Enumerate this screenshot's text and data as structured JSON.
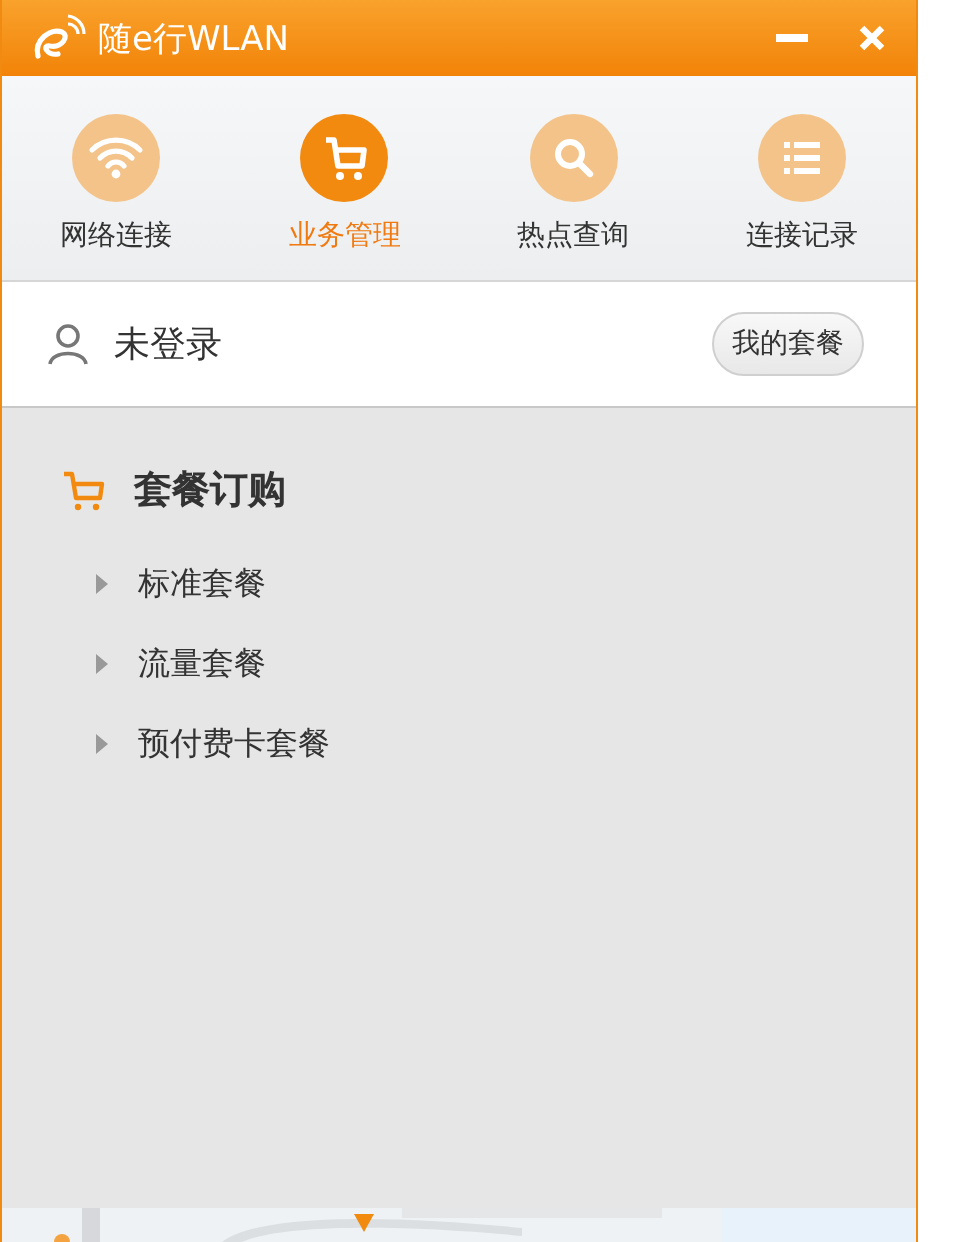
{
  "window": {
    "title": "随e行WLAN"
  },
  "nav": [
    {
      "label": "网络连接",
      "kind": "wifi",
      "selected": false
    },
    {
      "label": "业务管理",
      "kind": "cart",
      "selected": true
    },
    {
      "label": "热点查询",
      "kind": "search",
      "selected": false
    },
    {
      "label": "连接记录",
      "kind": "list",
      "selected": false
    }
  ],
  "user": {
    "status": "未登录",
    "button": "我的套餐"
  },
  "section": {
    "title": "套餐订购",
    "items": [
      {
        "label": "标准套餐",
        "expanded": false
      },
      {
        "label": "流量套餐",
        "expanded": false
      },
      {
        "label": "预付费卡套餐",
        "expanded": false
      }
    ]
  }
}
